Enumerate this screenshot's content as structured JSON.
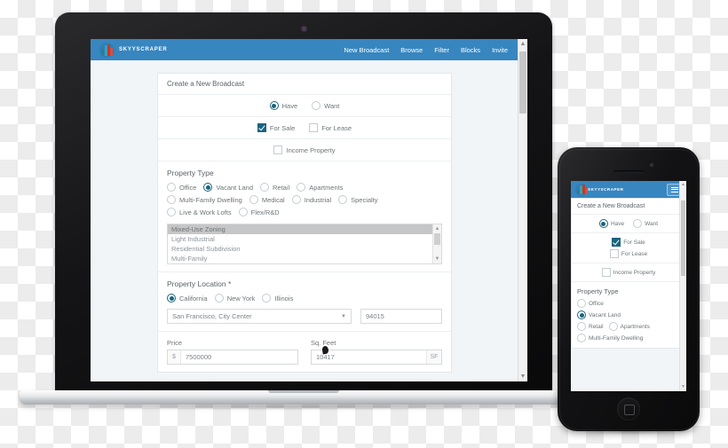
{
  "brand": {
    "name": "SKYYSCRAPER",
    "logo_icon": "skyscraper-logo-icon"
  },
  "nav": {
    "links": [
      {
        "label": "New Broadcast"
      },
      {
        "label": "Browse"
      },
      {
        "label": "Filter"
      },
      {
        "label": "Blocks"
      },
      {
        "label": "Invite"
      }
    ]
  },
  "form": {
    "title": "Create a New Broadcast",
    "listing_intent": [
      {
        "label": "Have",
        "selected": true
      },
      {
        "label": "Want",
        "selected": false
      }
    ],
    "sale_lease": [
      {
        "label": "For Sale",
        "checked": true
      },
      {
        "label": "For Lease",
        "checked": false
      }
    ],
    "income_property": {
      "label": "Income Property",
      "checked": false
    },
    "property_type": {
      "title": "Property Type",
      "options": [
        {
          "label": "Office",
          "selected": false
        },
        {
          "label": "Vacant Land",
          "selected": true
        },
        {
          "label": "Retail",
          "selected": false
        },
        {
          "label": "Apartments",
          "selected": false
        },
        {
          "label": "Multi-Family Dwelling",
          "selected": false
        },
        {
          "label": "Medical",
          "selected": false
        },
        {
          "label": "Industrial",
          "selected": false
        },
        {
          "label": "Specialty",
          "selected": false
        },
        {
          "label": "Live & Work Lofts",
          "selected": false
        },
        {
          "label": "Flex/R&D",
          "selected": false
        }
      ],
      "subtype_list": [
        {
          "label": "Mixed-Use Zoning",
          "selected": true
        },
        {
          "label": "Light Industrial",
          "selected": false
        },
        {
          "label": "Residential Subdivision",
          "selected": false
        },
        {
          "label": "Multi-Family",
          "selected": false
        }
      ]
    },
    "property_location": {
      "title": "Property Location *",
      "states": [
        {
          "label": "California",
          "selected": true
        },
        {
          "label": "New York",
          "selected": false
        },
        {
          "label": "Illinois",
          "selected": false
        }
      ],
      "city_select_value": "San Francisco, City Center",
      "zip_value": "94015"
    },
    "price": {
      "label": "Price",
      "currency_symbol": "$",
      "value": "7500000"
    },
    "sq_feet": {
      "label": "Sq. Feet",
      "value": "10417",
      "unit": "SF"
    }
  },
  "phone": {
    "title": "Create a New Broadcast",
    "listing_intent": [
      {
        "label": "Have",
        "selected": true
      },
      {
        "label": "Want",
        "selected": false
      }
    ],
    "sale_lease": [
      {
        "label": "For Sale",
        "checked": true
      },
      {
        "label": "For Lease",
        "checked": false
      }
    ],
    "income_property": {
      "label": "Income Property",
      "checked": false
    },
    "property_type_title": "Property Type",
    "property_type_options": [
      {
        "label": "Office",
        "selected": false
      },
      {
        "label": "Vacant Land",
        "selected": true
      },
      {
        "label": "Retail",
        "selected": false
      },
      {
        "label": "Apartments",
        "selected": false
      },
      {
        "label": "Multi-Family Dwelling",
        "selected": false
      }
    ],
    "menu_icon": "hamburger-menu-icon"
  },
  "colors": {
    "nav_blue": "#3786c0",
    "accent_teal": "#19647e",
    "page_background": "#f2f5f8",
    "logo_red": "#c0392b",
    "logo_teal": "#2e7d8f"
  }
}
